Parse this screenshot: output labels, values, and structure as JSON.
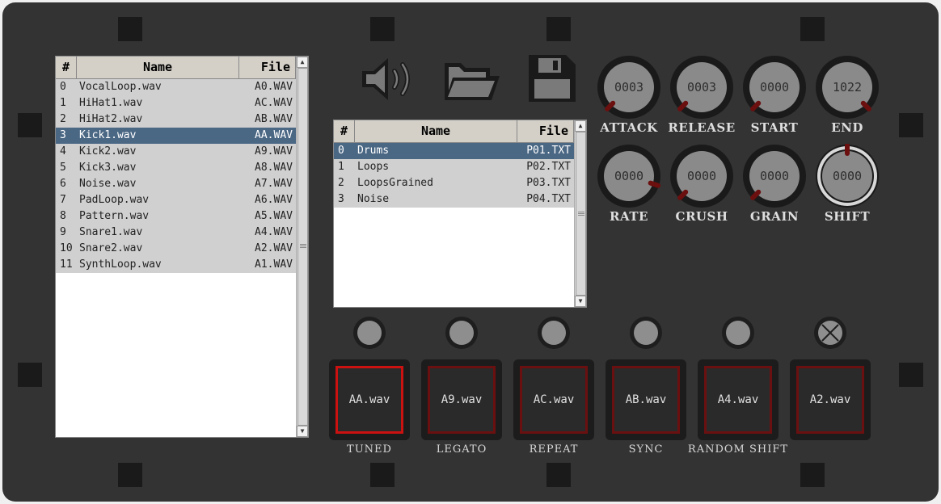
{
  "sample_list": {
    "headers": [
      "#",
      "Name",
      "File"
    ],
    "rows": [
      {
        "num": "0",
        "name": "VocalLoop.wav",
        "file": "A0.WAV"
      },
      {
        "num": "1",
        "name": "HiHat1.wav",
        "file": "AC.WAV"
      },
      {
        "num": "2",
        "name": "HiHat2.wav",
        "file": "AB.WAV"
      },
      {
        "num": "3",
        "name": "Kick1.wav",
        "file": "AA.WAV",
        "selected": true
      },
      {
        "num": "4",
        "name": "Kick2.wav",
        "file": "A9.WAV"
      },
      {
        "num": "5",
        "name": "Kick3.wav",
        "file": "A8.WAV"
      },
      {
        "num": "6",
        "name": "Noise.wav",
        "file": "A7.WAV"
      },
      {
        "num": "7",
        "name": "PadLoop.wav",
        "file": "A6.WAV"
      },
      {
        "num": "8",
        "name": "Pattern.wav",
        "file": "A5.WAV"
      },
      {
        "num": "9",
        "name": "Snare1.wav",
        "file": "A4.WAV"
      },
      {
        "num": "10",
        "name": "Snare2.wav",
        "file": "A2.WAV"
      },
      {
        "num": "11",
        "name": "SynthLoop.wav",
        "file": "A1.WAV"
      }
    ]
  },
  "preset_list": {
    "headers": [
      "#",
      "Name",
      "File"
    ],
    "rows": [
      {
        "num": "0",
        "name": "Drums",
        "file": "P01.TXT",
        "selected": true
      },
      {
        "num": "1",
        "name": "Loops",
        "file": "P02.TXT"
      },
      {
        "num": "2",
        "name": "LoopsGrained",
        "file": "P03.TXT"
      },
      {
        "num": "3",
        "name": "Noise",
        "file": "P04.TXT"
      }
    ]
  },
  "toolbar": {
    "icons": [
      "speaker-icon",
      "folder-open-icon",
      "save-icon"
    ]
  },
  "knobs": [
    {
      "label": "ATTACK",
      "value": "0003",
      "level": 0.0
    },
    {
      "label": "RELEASE",
      "value": "0003",
      "level": 0.0
    },
    {
      "label": "START",
      "value": "0000",
      "level": 0.0
    },
    {
      "label": "END",
      "value": "1022",
      "level": 1.0
    },
    {
      "label": "RATE",
      "value": "0000",
      "level": 0.9
    },
    {
      "label": "CRUSH",
      "value": "0000",
      "level": 0.0
    },
    {
      "label": "GRAIN",
      "value": "0000",
      "level": 0.0
    },
    {
      "label": "SHIFT",
      "value": "0000",
      "level": 0.5
    }
  ],
  "pads": [
    {
      "file": "AA.wav",
      "mode": "TUNED",
      "active": true
    },
    {
      "file": "A9.wav",
      "mode": "LEGATO"
    },
    {
      "file": "AC.wav",
      "mode": "REPEAT"
    },
    {
      "file": "AB.wav",
      "mode": "SYNC"
    },
    {
      "file": "A4.wav",
      "mode": "RANDOM SHIFT"
    },
    {
      "file": "A2.wav",
      "mode": "",
      "crossed": true
    }
  ],
  "colors": {
    "panel": "#333333",
    "selected_row": "#4a6784",
    "pad_border_active": "#cc1111",
    "pad_border": "#6a1010",
    "knob_indicator": "#6b0f0f"
  }
}
